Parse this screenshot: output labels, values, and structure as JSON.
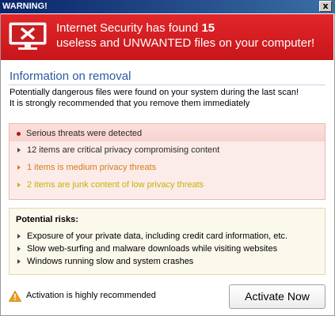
{
  "window": {
    "title": "WARNING!",
    "close_glyph": "x"
  },
  "banner": {
    "line1_prefix": "Internet Security has found ",
    "count": "15",
    "line2": "useless and UNWANTED files on your computer!",
    "icon": "monitor-error-icon"
  },
  "info": {
    "title": "Information on removal",
    "line1": "Potentially dangerous files were found on your system during the last scan!",
    "line2": "It is strongly recommended that you remove them immediately"
  },
  "threats": {
    "header": "Serious threats were detected",
    "items": [
      {
        "text": "12 items are critical privacy compromising content",
        "color": "#2a2a2a"
      },
      {
        "text": "1 items is medium privacy threats",
        "color": "#d77a16"
      },
      {
        "text": "2 items are junk content of low privacy threats",
        "color": "#c9b000"
      }
    ]
  },
  "risks": {
    "title": "Potential risks:",
    "items": [
      "Exposure of your private data, including credit card information, etc.",
      "Slow web-surfing and malware downloads while visiting websites",
      "Windows running slow and system crashes"
    ]
  },
  "footer": {
    "note": "Activation is highly recommended",
    "button_label": "Activate Now",
    "warning_icon": "warning-triangle-icon"
  },
  "colors": {
    "banner_red": "#d41e22",
    "title_blue": "#2b5aa0",
    "threat_bg": "#fbecea",
    "risk_bg": "#fbf8ec"
  }
}
